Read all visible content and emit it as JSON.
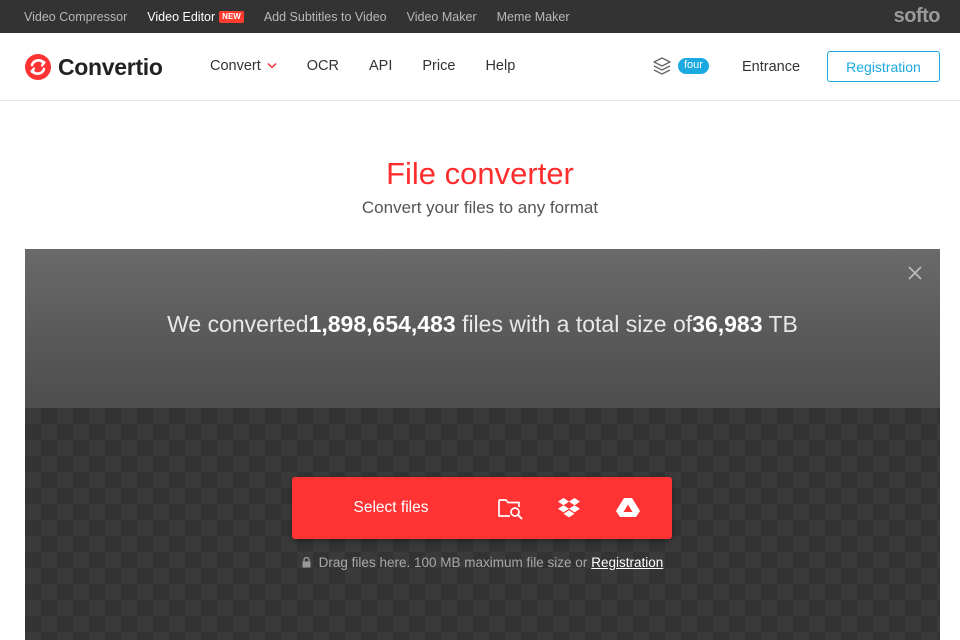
{
  "topbar": {
    "items": [
      {
        "label": "Video Compressor"
      },
      {
        "label": "Video Editor",
        "badge": "NEW"
      },
      {
        "label": "Add Subtitles to Video"
      },
      {
        "label": "Video Maker"
      },
      {
        "label": "Meme Maker"
      }
    ],
    "brand": "softo"
  },
  "header": {
    "logo_text": "Convertio",
    "nav": [
      {
        "label": "Convert",
        "icon": "chevron-down-icon"
      },
      {
        "label": "OCR"
      },
      {
        "label": "API"
      },
      {
        "label": "Price"
      },
      {
        "label": "Help"
      }
    ],
    "layers_icon": "layers-icon",
    "badge": "four",
    "entrance": "Entrance",
    "registration": "Registration"
  },
  "hero": {
    "title": "File converter",
    "subtitle": "Convert your files to any format"
  },
  "panel": {
    "stats_prefix": "We converted",
    "files_count": "1,898,654,483",
    "stats_middle": " files with a total size of",
    "total_size": "36,983",
    "size_unit": " TB",
    "select_label": "Select files",
    "sources": [
      "folder-search-icon",
      "dropbox-icon",
      "google-drive-icon"
    ],
    "drag_text": "Drag files here. 100 MB maximum file size or",
    "drag_link": "Registration"
  },
  "colors": {
    "accent_red": "#ff3333",
    "accent_blue": "#1aa9e1",
    "topbar_bg": "#333333"
  }
}
